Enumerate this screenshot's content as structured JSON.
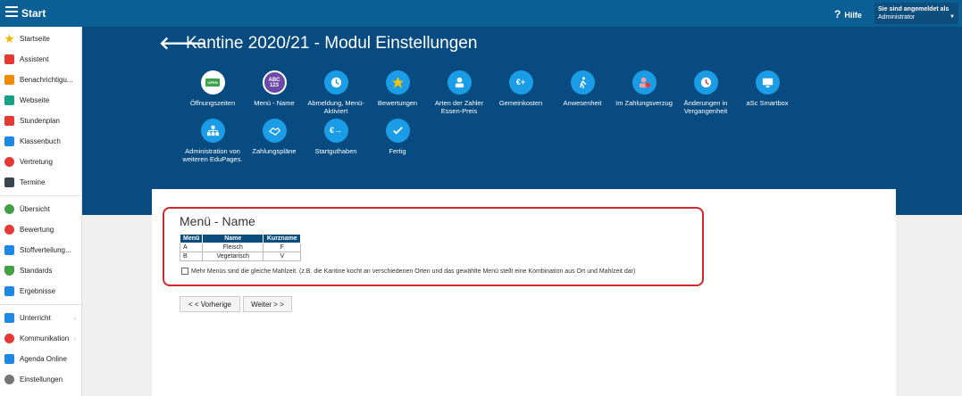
{
  "topbar": {
    "start_label": "Start",
    "help_label": "Hilfe",
    "user_line1": "Sie sind angemeldet als",
    "user_line2": "Administrator"
  },
  "sidebar": {
    "items": [
      {
        "label": "Startseite",
        "icon": "star-icon",
        "color": "#f4b400"
      },
      {
        "label": "Assistent",
        "icon": "wand-icon",
        "color": "#e53935"
      },
      {
        "label": "Benachrichtigu...",
        "icon": "mail-icon",
        "color": "#f28b00"
      },
      {
        "label": "Webseite",
        "icon": "home-icon",
        "color": "#16a085"
      },
      {
        "label": "Stundenplan",
        "icon": "grid-icon",
        "color": "#e53935"
      },
      {
        "label": "Klassenbuch",
        "icon": "book-icon",
        "color": "#1e88e5"
      },
      {
        "label": "Vertretung",
        "icon": "swap-icon",
        "color": "#e53935"
      },
      {
        "label": "Termine",
        "icon": "calendar-icon",
        "color": "#37474f"
      },
      {
        "label": "Übersicht",
        "icon": "check-icon",
        "color": "#43a047"
      },
      {
        "label": "Bewertung",
        "icon": "badge-icon",
        "color": "#e53935"
      },
      {
        "label": "Stoffverteilung...",
        "icon": "list-icon",
        "color": "#1e88e5"
      },
      {
        "label": "Standards",
        "icon": "shield-icon",
        "color": "#43a047"
      },
      {
        "label": "Ergebnisse",
        "icon": "bar-chart-icon",
        "color": "#1e88e5"
      },
      {
        "label": "Unterricht",
        "icon": "briefcase-icon",
        "color": "#1e88e5"
      },
      {
        "label": "Kommunikation",
        "icon": "chat-icon",
        "color": "#e53935"
      },
      {
        "label": "Agenda Online",
        "icon": "pen-icon",
        "color": "#1e88e5"
      },
      {
        "label": "Einstellungen",
        "icon": "gear-icon",
        "color": "#757575"
      }
    ]
  },
  "page": {
    "title": "Kantine 2020/21 - Modul Einstellungen"
  },
  "tiles": [
    {
      "label": "Öffnungszeiten",
      "icon": "open-sign-icon"
    },
    {
      "label": "Menü - Name",
      "icon": "abc-icon"
    },
    {
      "label": "Abmeldung, Menü-Aktiviert",
      "icon": "clock-icon"
    },
    {
      "label": "Bewertungen",
      "icon": "star-icon"
    },
    {
      "label": "Arten der Zahler Essen-Preis",
      "icon": "person-money-icon"
    },
    {
      "label": "Gemeinkosten",
      "icon": "euro-plus-icon"
    },
    {
      "label": "Anwesenheit",
      "icon": "walking-icon"
    },
    {
      "label": "Im Zahlungsverzug",
      "icon": "person-alert-icon"
    },
    {
      "label": "Änderungen in Vergangenheit",
      "icon": "history-icon"
    },
    {
      "label": "aSc Smartbox",
      "icon": "monitor-icon"
    },
    {
      "label": "Administration von weiteren EduPages.",
      "icon": "network-icon"
    },
    {
      "label": "Zahlungspläne",
      "icon": "handshake-icon"
    },
    {
      "label": "Startguthaben",
      "icon": "euro-arrow-icon"
    },
    {
      "label": "Fertig",
      "icon": "checkmark-icon"
    }
  ],
  "section": {
    "title": "Menü - Name",
    "table": {
      "headers": [
        "Menü",
        "Name",
        "Kurzname"
      ],
      "rows": [
        [
          "A",
          "Fleisch",
          "F"
        ],
        [
          "B",
          "Vegetarisch",
          "V"
        ]
      ]
    },
    "checkbox_label": "Mehr Menüs sind die gleiche Mahlzeit. (z.B. die Kantine kocht an verschiedenen Orten und das gewählte Menü stellt eine Kombination aus Ort und Mahlzeit dar)",
    "checkbox_checked": false
  },
  "buttons": {
    "prev": "< < Vorherige",
    "next": "Weiter > >"
  }
}
